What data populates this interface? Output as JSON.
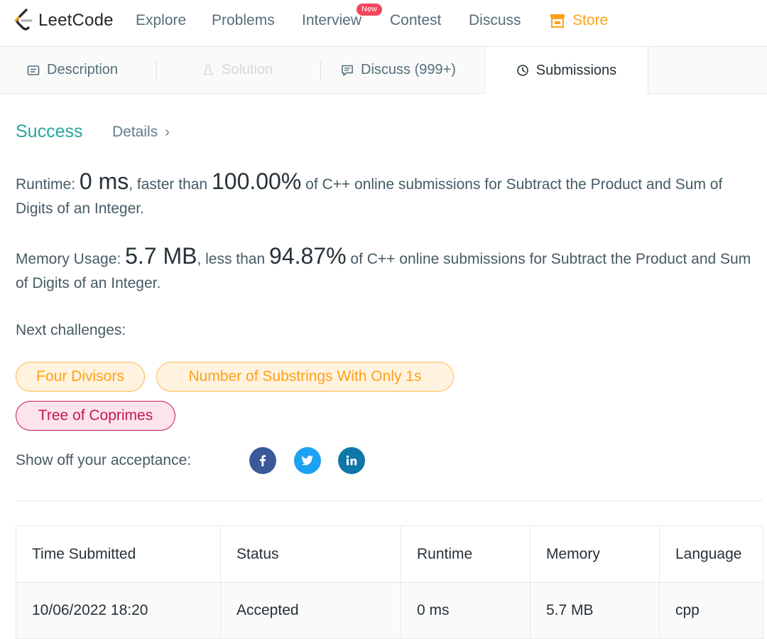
{
  "nav": {
    "logo_text": "LeetCode",
    "items": [
      "Explore",
      "Problems",
      "Interview",
      "Contest",
      "Discuss"
    ],
    "store": "Store",
    "new_badge": "New"
  },
  "tabs": {
    "description": "Description",
    "solution": "Solution",
    "discuss": "Discuss (999+)",
    "submissions": "Submissions"
  },
  "result": {
    "status": "Success",
    "details": "Details",
    "runtime_label": "Runtime:",
    "runtime_value": "0 ms",
    "runtime_mid": ", faster than",
    "runtime_percent": "100.00%",
    "runtime_tail": "of C++ online submissions for Subtract the Product and Sum of Digits of an Integer.",
    "memory_label": "Memory Usage:",
    "memory_value": "5.7 MB",
    "memory_mid": ", less than",
    "memory_percent": "94.87%",
    "memory_tail": "of C++ online submissions for Subtract the Product and Sum of Digits of an Integer."
  },
  "challenges": {
    "label": "Next challenges:",
    "items": [
      {
        "title": "Four Divisors",
        "difficulty": "medium"
      },
      {
        "title": "Number of Substrings With Only 1s",
        "difficulty": "medium"
      },
      {
        "title": "Tree of Coprimes",
        "difficulty": "hard"
      }
    ]
  },
  "share": {
    "label": "Show off your acceptance:",
    "icons": [
      "facebook-icon",
      "twitter-icon",
      "linkedin-icon"
    ]
  },
  "table": {
    "headers": [
      "Time Submitted",
      "Status",
      "Runtime",
      "Memory",
      "Language"
    ],
    "rows": [
      [
        "10/06/2022 18:20",
        "Accepted",
        "0 ms",
        "5.7 MB",
        "cpp"
      ]
    ]
  },
  "colors": {
    "accent_orange": "#ffa116",
    "success_teal": "#26a69a",
    "hard_pink": "#c2185b",
    "new_badge_red": "#f5455c"
  }
}
